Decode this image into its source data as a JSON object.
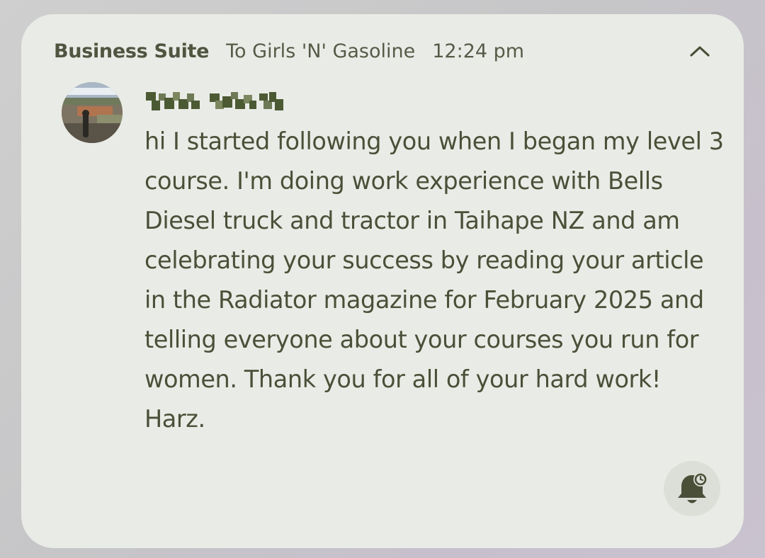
{
  "notification": {
    "app_name": "Business Suite",
    "recipient": "To Girls 'N' Gasoline",
    "time": "12:24 pm",
    "sender_name_redacted": true,
    "message": "hi I started following you when I began my level 3 course. I'm doing work experience with Bells Diesel truck and tractor in Taihape NZ and am celebrating your success by reading your article in the Radiator magazine for February 2025 and telling everyone about your courses you run for women. Thank you for all of your hard work! Harz."
  },
  "icons": {
    "collapse": "chevron-up-icon",
    "snooze": "bell-snooze-icon"
  },
  "colors": {
    "card_background": "#e9ebe6",
    "text": "#4a5038",
    "button_background": "#dcdfd8"
  }
}
